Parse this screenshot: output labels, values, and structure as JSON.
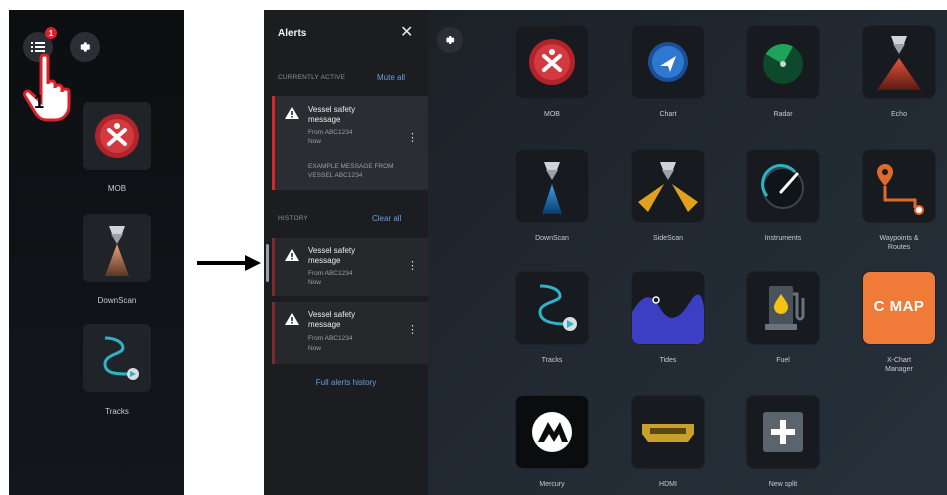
{
  "left_panel": {
    "badge_count": "1",
    "step_number": "1",
    "tiles": [
      {
        "label": "MOB"
      },
      {
        "label": "DownScan"
      },
      {
        "label": "Tracks"
      }
    ]
  },
  "alerts": {
    "title": "Alerts",
    "currently_active_label": "CURRENTLY ACTIVE",
    "mute_all_label": "Mute all",
    "history_label": "HISTORY",
    "clear_all_label": "Clear all",
    "active": [
      {
        "title": "Vessel safety message",
        "from": "From ABC1234",
        "time": "Now",
        "message": "EXAMPLE MESSAGE FROM VESSEL ABC1234"
      }
    ],
    "history": [
      {
        "title": "Vessel safety message",
        "from": "From ABC1234",
        "time": "Now"
      },
      {
        "title": "Vessel safety message",
        "from": "From ABC1234",
        "time": "Now"
      }
    ],
    "full_history_label": "Full alerts history"
  },
  "apps": [
    {
      "label": "MOB",
      "icon": "mob-icon"
    },
    {
      "label": "Chart",
      "icon": "chart-icon"
    },
    {
      "label": "Radar",
      "icon": "radar-icon"
    },
    {
      "label": "Echo",
      "icon": "echo-icon"
    },
    {
      "label": "DownScan",
      "icon": "downscan-icon"
    },
    {
      "label": "SideScan",
      "icon": "sidescan-icon"
    },
    {
      "label": "Instruments",
      "icon": "instruments-icon"
    },
    {
      "label": "Waypoints & Routes",
      "icon": "waypoints-icon"
    },
    {
      "label": "Tracks",
      "icon": "tracks-icon"
    },
    {
      "label": "Tides",
      "icon": "tides-icon"
    },
    {
      "label": "Fuel",
      "icon": "fuel-icon"
    },
    {
      "label": "X-Chart Manager",
      "icon": "cmap-icon",
      "logo_text": "C MAP"
    },
    {
      "label": "Mercury",
      "icon": "mercury-icon"
    },
    {
      "label": "HDMI",
      "icon": "hdmi-icon"
    },
    {
      "label": "New split",
      "icon": "plus-icon"
    }
  ],
  "colors": {
    "accent_link": "#6b9fe0",
    "alert_red": "#d6262c",
    "mob_red": "#c4262c"
  }
}
